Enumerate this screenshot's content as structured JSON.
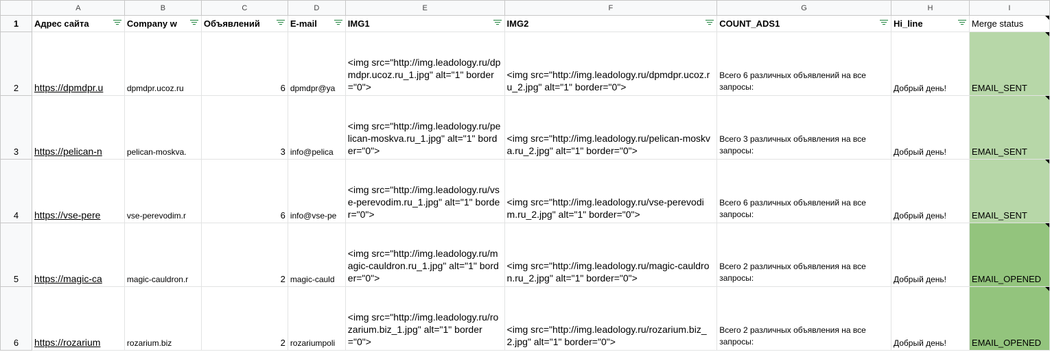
{
  "columns": [
    "A",
    "B",
    "C",
    "D",
    "E",
    "F",
    "G",
    "H",
    "I"
  ],
  "row_numbers": [
    "1",
    "2",
    "3",
    "4",
    "5",
    "6"
  ],
  "headers": [
    "Адрес сайта",
    "Company w",
    "Объявлений",
    "E-mail",
    "IMG1",
    "IMG2",
    "COUNT_ADS1",
    "Hi_line",
    "Merge status"
  ],
  "rows": [
    {
      "url": "https://dpmdpr.u",
      "company": "dpmdpr.ucoz.ru",
      "count": "6",
      "email": "dpmdpr@ya",
      "img1": "<img src=\"http://img.leadology.ru/dpmdpr.ucoz.ru_1.jpg\" alt=\"1\" border=\"0\">",
      "img2": "<img src=\"http://img.leadology.ru/dpmdpr.ucoz.ru_2.jpg\" alt=\"1\" border=\"0\">",
      "count_ads": "Всего 6 различных объявлений на все запросы:",
      "hi": "Добрый день!",
      "status": "EMAIL_SENT"
    },
    {
      "url": "https://pelican-n",
      "company": "pelican-moskva.",
      "count": "3",
      "email": "info@pelica",
      "img1": "<img src=\"http://img.leadology.ru/pelican-moskva.ru_1.jpg\" alt=\"1\" border=\"0\">",
      "img2": "<img src=\"http://img.leadology.ru/pelican-moskva.ru_2.jpg\" alt=\"1\" border=\"0\">",
      "count_ads": "Всего 3 различных объявления на все запросы:",
      "hi": "Добрый день!",
      "status": "EMAIL_SENT"
    },
    {
      "url": "https://vse-pere",
      "company": "vse-perevodim.r",
      "count": "6",
      "email": "info@vse-pe",
      "img1": "<img src=\"http://img.leadology.ru/vse-perevodim.ru_1.jpg\" alt=\"1\" border=\"0\">",
      "img2": "<img src=\"http://img.leadology.ru/vse-perevodim.ru_2.jpg\" alt=\"1\" border=\"0\">",
      "count_ads": "Всего 6 различных объявлений на все запросы:",
      "hi": "Добрый день!",
      "status": "EMAIL_SENT"
    },
    {
      "url": "https://magic-ca",
      "company": "magic-cauldron.r",
      "count": "2",
      "email": "magic-cauld",
      "img1": "<img src=\"http://img.leadology.ru/magic-cauldron.ru_1.jpg\" alt=\"1\" border=\"0\">",
      "img2": "<img src=\"http://img.leadology.ru/magic-cauldron.ru_2.jpg\" alt=\"1\" border=\"0\">",
      "count_ads": "Всего 2 различных объявления на все запросы:",
      "hi": "Добрый день!",
      "status": "EMAIL_OPENED"
    },
    {
      "url": "https://rozarium",
      "company": "rozarium.biz",
      "count": "2",
      "email": "rozariumpoli",
      "img1": "<img src=\"http://img.leadology.ru/rozarium.biz_1.jpg\" alt=\"1\" border=\"0\">",
      "img2": "<img src=\"http://img.leadology.ru/rozarium.biz_2.jpg\" alt=\"1\" border=\"0\">",
      "count_ads": "Всего 2 различных объявления на все запросы:",
      "hi": "Добрый день!",
      "status": "EMAIL_OPENED"
    }
  ],
  "colors": {
    "sent": "#b7d7a8",
    "opened": "#93c47d",
    "filter": "#188038"
  }
}
